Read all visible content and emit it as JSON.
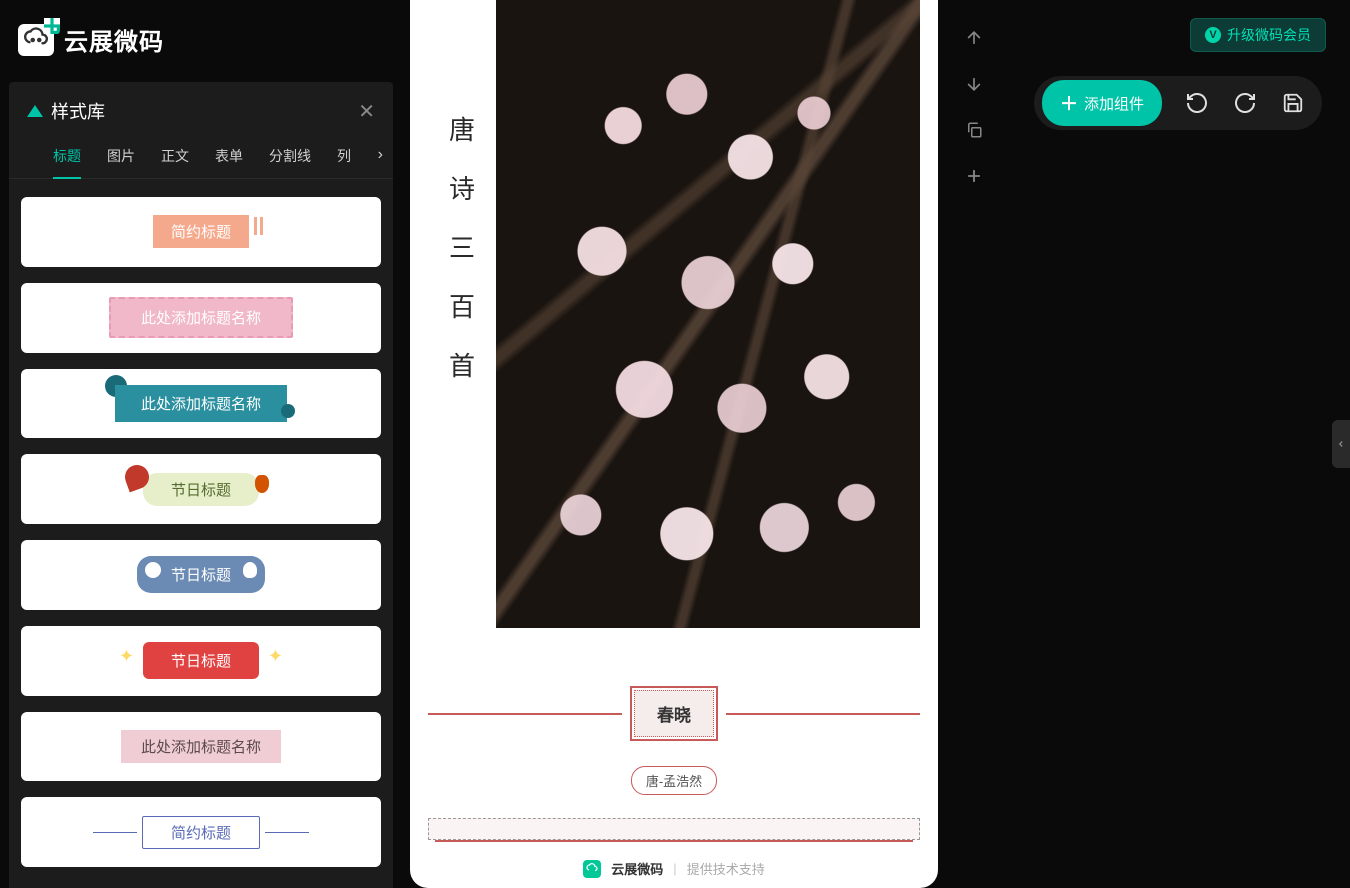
{
  "brand": "云展微码",
  "upgrade_label": "升级微码会员",
  "panel": {
    "title": "样式库",
    "tabs": [
      "标题",
      "图片",
      "正文",
      "表单",
      "分割线",
      "列"
    ]
  },
  "styles": [
    {
      "label": "简约标题"
    },
    {
      "label": "此处添加标题名称"
    },
    {
      "label": "此处添加标题名称"
    },
    {
      "label": "节日标题"
    },
    {
      "label": "节日标题"
    },
    {
      "label": "节日标题"
    },
    {
      "label": "此处添加标题名称"
    },
    {
      "label": "简约标题"
    }
  ],
  "canvas": {
    "vertical_title": [
      "唐",
      "诗",
      "三",
      "百",
      "首"
    ],
    "poem_title": "春晓",
    "poem_author": "唐-孟浩然",
    "footer_brand": "云展微码",
    "footer_tag": "提供技术支持"
  },
  "actions": {
    "add_component": "添加组件"
  }
}
